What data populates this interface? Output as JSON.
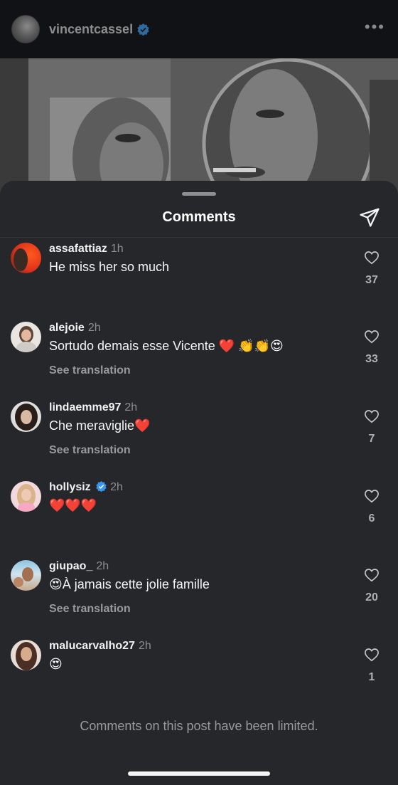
{
  "post": {
    "username": "vincentcassel",
    "verified": true,
    "more_icon": "more-horizontal-icon"
  },
  "sheet": {
    "title": "Comments",
    "share_icon": "paper-plane-icon",
    "limited_notice": "Comments on this post have been limited."
  },
  "comments": [
    {
      "username": "assafattiaz",
      "time": "1h",
      "text": "He miss her so much",
      "translate": "",
      "likes": "37",
      "verified": false
    },
    {
      "username": "alejoie",
      "time": "2h",
      "text": "Sortudo demais esse Vicente ❤️ 👏👏😍",
      "translate": "See translation",
      "likes": "33",
      "verified": false
    },
    {
      "username": "lindaemme97",
      "time": "2h",
      "text": "Che meraviglie❤️",
      "translate": "See translation",
      "likes": "7",
      "verified": false
    },
    {
      "username": "hollysiz",
      "time": "2h",
      "text": "❤️❤️❤️",
      "translate": "",
      "likes": "6",
      "verified": true
    },
    {
      "username": "giupao_",
      "time": "2h",
      "text": "😍À jamais cette jolie famille",
      "translate": "See translation",
      "likes": "20",
      "verified": false
    },
    {
      "username": "malucarvalho27",
      "time": "2h",
      "text": "😍",
      "translate": "",
      "likes": "1",
      "verified": false
    }
  ],
  "colors": {
    "sheet_background": "#26272b",
    "verified_blue": "#3897f0",
    "muted_text": "#9a9a9e"
  }
}
